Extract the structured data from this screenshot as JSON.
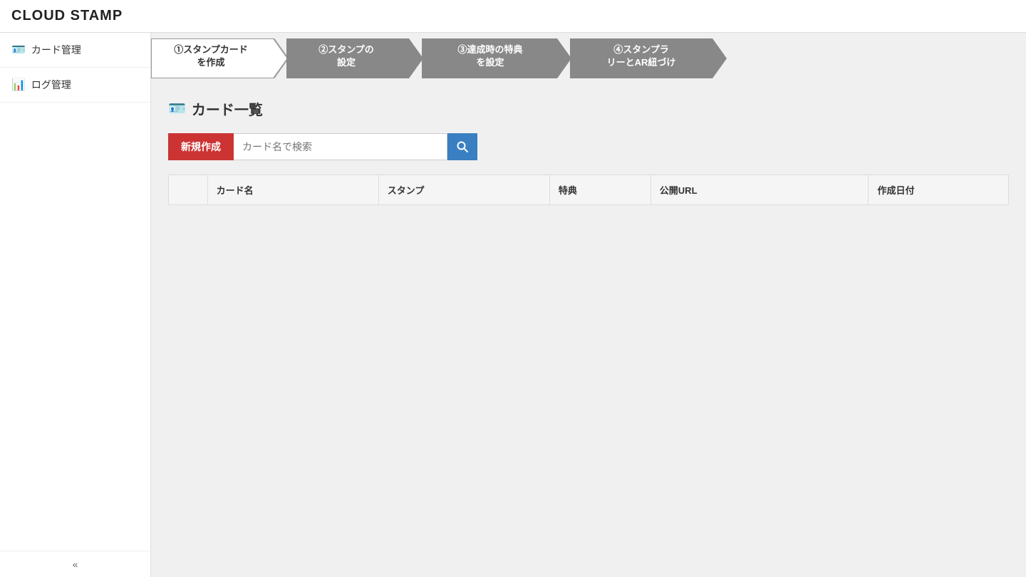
{
  "header": {
    "title": "CLOUD STAMP"
  },
  "sidebar": {
    "items": [
      {
        "id": "card-mgmt",
        "label": "カード管理",
        "icon": "🪪"
      },
      {
        "id": "log-mgmt",
        "label": "ログ管理",
        "icon": "📊"
      }
    ],
    "collapse_label": "«"
  },
  "wizard": {
    "steps": [
      {
        "id": "step1",
        "label": "①スタンプカード\nを作成",
        "active": true
      },
      {
        "id": "step2",
        "label": "②スタンプの\n設定",
        "active": false
      },
      {
        "id": "step3",
        "label": "③達成時の特典\nを設定",
        "active": false
      },
      {
        "id": "step4",
        "label": "④スタンプラ\nリーとAR紐づけ",
        "active": false
      }
    ]
  },
  "page": {
    "title": "カード一覧",
    "title_icon": "🪪"
  },
  "toolbar": {
    "new_button_label": "新規作成",
    "search_placeholder": "カード名で検索",
    "search_button_label": "🔍"
  },
  "table": {
    "columns": [
      {
        "id": "checkbox",
        "label": ""
      },
      {
        "id": "name",
        "label": "カード名"
      },
      {
        "id": "stamp",
        "label": "スタンプ"
      },
      {
        "id": "benefit",
        "label": "特典"
      },
      {
        "id": "url",
        "label": "公開URL"
      },
      {
        "id": "date",
        "label": "作成日付"
      }
    ],
    "rows": []
  },
  "colors": {
    "accent_red": "#cc3333",
    "accent_blue": "#3a7fc1",
    "step_active_bg": "#ffffff",
    "step_inactive_bg": "#888888",
    "step_active_border": "#999999"
  }
}
